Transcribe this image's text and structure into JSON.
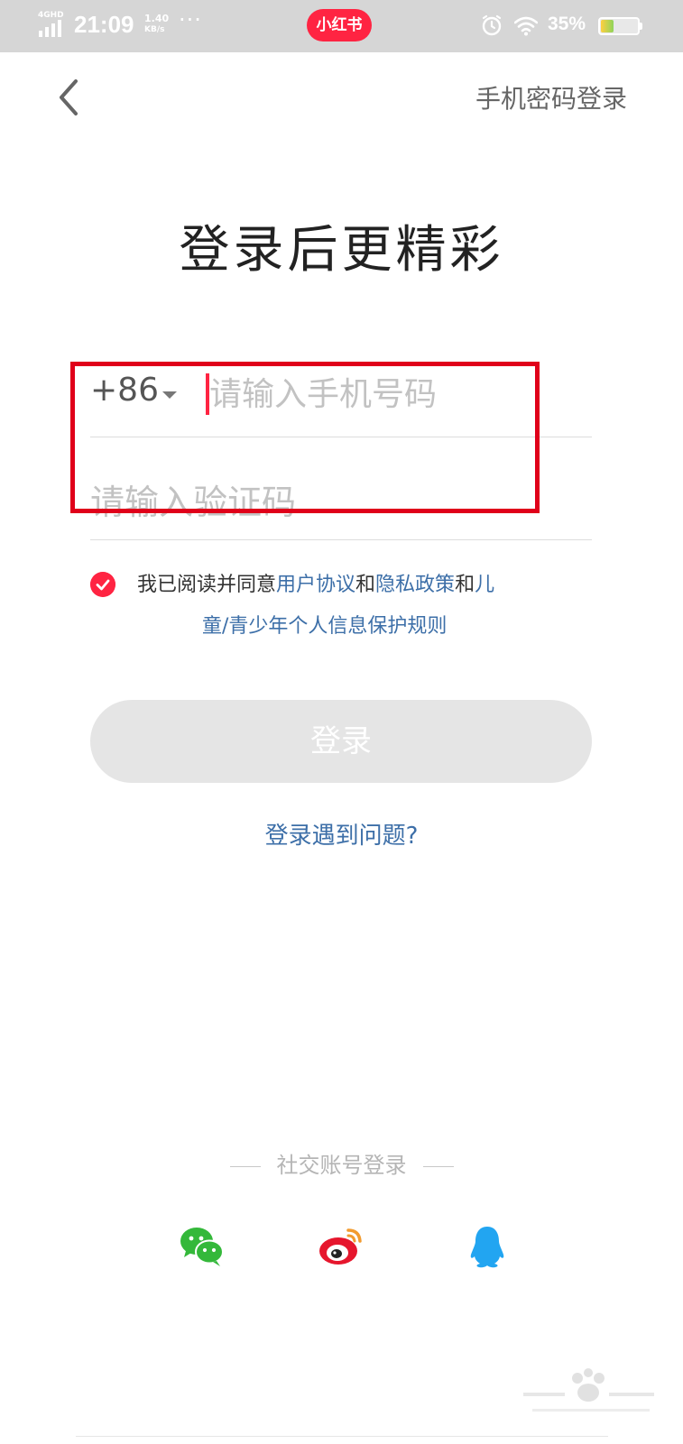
{
  "status_bar": {
    "network": "4GHD",
    "time": "21:09",
    "speed_value": "1.40",
    "speed_unit": "KB/s",
    "more": "···",
    "app_badge": "小红书",
    "battery_percent": "35%",
    "icons": [
      "signal-icon",
      "alarm-icon",
      "wifi-icon",
      "battery-icon"
    ]
  },
  "header": {
    "back_icon": "chevron-left-icon",
    "alt_login_label": "手机密码登录"
  },
  "title": "登录后更精彩",
  "form": {
    "country_code": "+86",
    "phone_placeholder": "请输入手机号码",
    "phone_value": "",
    "code_placeholder": "请输入验证码",
    "code_value": ""
  },
  "agreement": {
    "checked": true,
    "prefix": "我已阅读并同意",
    "link_user_agreement": "用户协议",
    "and1": "和",
    "link_privacy": "隐私政策",
    "and2": "和",
    "link_children_part1": "儿",
    "link_children_part2": "童/青少年个人信息保护规则"
  },
  "login_button_label": "登录",
  "trouble_link": "登录遇到问题?",
  "social": {
    "title": "社交账号登录",
    "providers": [
      "wechat-icon",
      "weibo-icon",
      "qq-icon"
    ]
  },
  "colors": {
    "brand": "#ff2442",
    "link": "#3d6fa8",
    "highlight_box": "#e0001a",
    "wechat": "#34b83a",
    "weibo": "#e6162d",
    "qq": "#22a5f1"
  }
}
